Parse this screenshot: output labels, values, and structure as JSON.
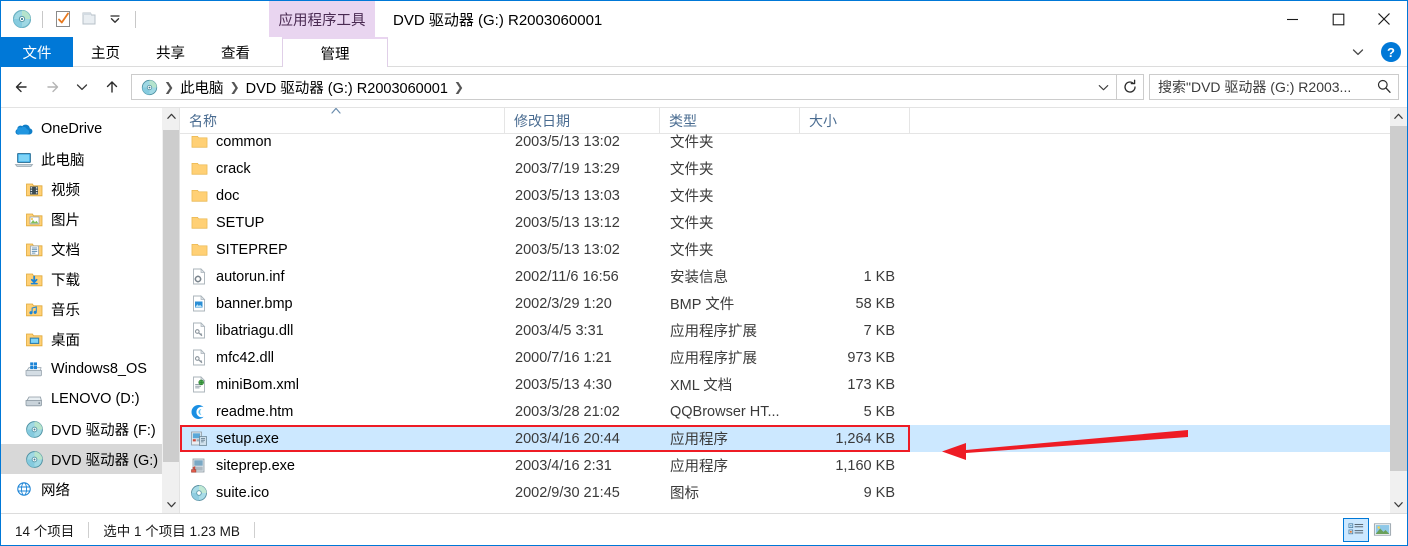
{
  "window": {
    "title": "DVD 驱动器 (G:) R2003060001",
    "contextual_tab_header": "应用程序工具",
    "controls": {
      "minimize": "minimize-icon",
      "maximize": "maximize-icon",
      "close": "close-icon"
    }
  },
  "quick_access": {
    "items": [
      {
        "name": "dvd-drive-icon",
        "label": ""
      },
      {
        "name": "properties-icon",
        "label": ""
      },
      {
        "name": "new-folder-icon",
        "label": ""
      },
      {
        "name": "customize-dropdown-icon",
        "label": ""
      }
    ]
  },
  "ribbon": {
    "tabs": [
      {
        "label": "文件",
        "active": false,
        "style": "file"
      },
      {
        "label": "主页",
        "active": false,
        "style": "normal"
      },
      {
        "label": "共享",
        "active": false,
        "style": "normal"
      },
      {
        "label": "查看",
        "active": false,
        "style": "normal"
      },
      {
        "label": "管理",
        "active": true,
        "style": "contextual"
      }
    ],
    "expand_label": "",
    "help_label": "?"
  },
  "address_bar": {
    "back": "back-arrow-icon",
    "forward": "forward-arrow-icon",
    "recent": "recent-locations-icon",
    "up": "up-arrow-icon",
    "breadcrumbs": [
      "此电脑",
      "DVD 驱动器 (G:) R2003060001"
    ],
    "dropdown": "chevron-down-icon",
    "refresh": "refresh-icon"
  },
  "search": {
    "value": "搜索\"DVD 驱动器 (G:) R2003...",
    "placeholder": "搜索\"DVD 驱动器 (G:) R2003...",
    "icon": "search-icon"
  },
  "sidebar": {
    "items": [
      {
        "label": "OneDrive",
        "icon": "onedrive-cloud-icon",
        "level": 0,
        "selected": false
      },
      {
        "label": "此电脑",
        "icon": "this-pc-icon",
        "level": 0,
        "selected": false
      },
      {
        "label": "视频",
        "icon": "videos-folder-icon",
        "level": 1,
        "selected": false
      },
      {
        "label": "图片",
        "icon": "pictures-folder-icon",
        "level": 1,
        "selected": false
      },
      {
        "label": "文档",
        "icon": "documents-folder-icon",
        "level": 1,
        "selected": false
      },
      {
        "label": "下载",
        "icon": "downloads-folder-icon",
        "level": 1,
        "selected": false
      },
      {
        "label": "音乐",
        "icon": "music-folder-icon",
        "level": 1,
        "selected": false
      },
      {
        "label": "桌面",
        "icon": "desktop-folder-icon",
        "level": 1,
        "selected": false
      },
      {
        "label": "Windows8_OS",
        "icon": "windows-drive-icon",
        "level": 1,
        "selected": false
      },
      {
        "label": "LENOVO (D:)",
        "icon": "hard-drive-icon",
        "level": 1,
        "selected": false
      },
      {
        "label": "DVD 驱动器 (F:)",
        "icon": "dvd-drive-icon",
        "level": 1,
        "selected": false
      },
      {
        "label": "DVD 驱动器 (G:)",
        "icon": "dvd-drive-icon",
        "level": 1,
        "selected": true
      },
      {
        "label": "网络",
        "icon": "network-icon",
        "level": 0,
        "selected": false
      }
    ]
  },
  "file_list": {
    "columns": [
      "名称",
      "修改日期",
      "类型",
      "大小"
    ],
    "sort_column": "名称",
    "sort_direction": "asc",
    "rows": [
      {
        "name": "common",
        "icon": "folder-icon",
        "date": "2003/5/13 13:02",
        "type": "文件夹",
        "size": "",
        "selected": false
      },
      {
        "name": "crack",
        "icon": "folder-icon",
        "date": "2003/7/19 13:29",
        "type": "文件夹",
        "size": "",
        "selected": false
      },
      {
        "name": "doc",
        "icon": "folder-icon",
        "date": "2003/5/13 13:03",
        "type": "文件夹",
        "size": "",
        "selected": false
      },
      {
        "name": "SETUP",
        "icon": "folder-icon",
        "date": "2003/5/13 13:12",
        "type": "文件夹",
        "size": "",
        "selected": false
      },
      {
        "name": "SITEPREP",
        "icon": "folder-icon",
        "date": "2003/5/13 13:02",
        "type": "文件夹",
        "size": "",
        "selected": false
      },
      {
        "name": "autorun.inf",
        "icon": "inf-file-icon",
        "date": "2002/11/6 16:56",
        "type": "安装信息",
        "size": "1 KB",
        "selected": false
      },
      {
        "name": "banner.bmp",
        "icon": "bmp-file-icon",
        "date": "2002/3/29 1:20",
        "type": "BMP 文件",
        "size": "58 KB",
        "selected": false
      },
      {
        "name": "libatriagu.dll",
        "icon": "dll-file-icon",
        "date": "2003/4/5 3:31",
        "type": "应用程序扩展",
        "size": "7 KB",
        "selected": false
      },
      {
        "name": "mfc42.dll",
        "icon": "dll-file-icon",
        "date": "2000/7/16 1:21",
        "type": "应用程序扩展",
        "size": "973 KB",
        "selected": false
      },
      {
        "name": "miniBom.xml",
        "icon": "xml-file-icon",
        "date": "2003/5/13 4:30",
        "type": "XML 文档",
        "size": "173 KB",
        "selected": false
      },
      {
        "name": "readme.htm",
        "icon": "qqbrowser-icon",
        "date": "2003/3/28 21:02",
        "type": "QQBrowser HT...",
        "size": "5 KB",
        "selected": false
      },
      {
        "name": "setup.exe",
        "icon": "setup-exe-icon",
        "date": "2003/4/16 20:44",
        "type": "应用程序",
        "size": "1,264 KB",
        "selected": true
      },
      {
        "name": "siteprep.exe",
        "icon": "siteprep-exe-icon",
        "date": "2003/4/16 2:31",
        "type": "应用程序",
        "size": "1,160 KB",
        "selected": false
      },
      {
        "name": "suite.ico",
        "icon": "ico-file-icon",
        "date": "2002/9/30 21:45",
        "type": "图标",
        "size": "9 KB",
        "selected": false
      }
    ]
  },
  "status_bar": {
    "item_count": "14 个项目",
    "selection": "选中 1 个项目  1.23 MB",
    "views": [
      {
        "name": "details-view-button",
        "active": true
      },
      {
        "name": "large-icons-view-button",
        "active": false
      }
    ]
  },
  "annotation": {
    "arrow_color": "#ee1c25",
    "highlight_color": "#ee1c25"
  },
  "colors": {
    "accent": "#0078d7",
    "selection": "#cce8ff",
    "contextual_tab": "#e9d5f0",
    "folder_yellow": "#ffd075"
  }
}
